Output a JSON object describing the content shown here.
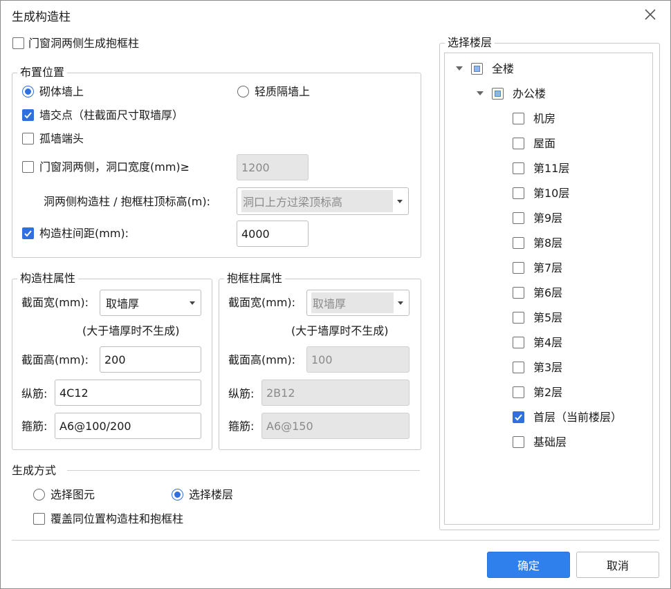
{
  "dialog": {
    "title": "生成构造柱"
  },
  "door_window_cb": {
    "label": "门窗洞两侧生成抱框柱",
    "checked": false
  },
  "placement": {
    "legend": "布置位置",
    "radio_masonry": "砌体墙上",
    "radio_light": "轻质隔墙上",
    "wall_intersection": "墙交点（柱截面尺寸取墙厚）",
    "lone_wall_end": "孤墙端头",
    "opening_sides": "门窗洞两侧，洞口宽度(mm)≥",
    "opening_width": "1200",
    "top_elev_label": "洞两侧构造柱 / 抱框柱顶标高(m):",
    "top_elev_value": "洞口上方过梁顶标高",
    "spacing_label": "构造柱间距(mm):",
    "spacing_value": "4000"
  },
  "col_props": {
    "legend": "构造柱属性",
    "width_label": "截面宽(mm):",
    "width_value": "取墙厚",
    "note": "(大于墙厚时不生成)",
    "height_label": "截面高(mm):",
    "height_value": "200",
    "long_bar_label": "纵筋:",
    "long_bar_value": "4C12",
    "stirrup_label": "箍筋:",
    "stirrup_value": "A6@100/200"
  },
  "frame_props": {
    "legend": "抱框柱属性",
    "width_label": "截面宽(mm):",
    "width_value": "取墙厚",
    "note": "(大于墙厚时不生成)",
    "height_label": "截面高(mm):",
    "height_value": "100",
    "long_bar_label": "纵筋:",
    "long_bar_value": "2B12",
    "stirrup_label": "箍筋:",
    "stirrup_value": "A6@150"
  },
  "gen_mode": {
    "legend": "生成方式",
    "radio_select_element": "选择图元",
    "radio_select_floor": "选择楼层",
    "overwrite": "覆盖同位置构造柱和抱框柱"
  },
  "floors": {
    "legend": "选择楼层",
    "root": "全楼",
    "building": "办公楼",
    "items": [
      {
        "label": "机房",
        "checked": false
      },
      {
        "label": "屋面",
        "checked": false
      },
      {
        "label": "第11层",
        "checked": false
      },
      {
        "label": "第10层",
        "checked": false
      },
      {
        "label": "第9层",
        "checked": false
      },
      {
        "label": "第8层",
        "checked": false
      },
      {
        "label": "第7层",
        "checked": false
      },
      {
        "label": "第6层",
        "checked": false
      },
      {
        "label": "第5层",
        "checked": false
      },
      {
        "label": "第4层",
        "checked": false
      },
      {
        "label": "第3层",
        "checked": false
      },
      {
        "label": "第2层",
        "checked": false
      },
      {
        "label": "首层（当前楼层）",
        "checked": true
      },
      {
        "label": "基础层",
        "checked": false
      }
    ]
  },
  "buttons": {
    "ok": "确定",
    "cancel": "取消"
  },
  "colors": {
    "accent": "#2f80ed",
    "check": "#2f6fde"
  }
}
